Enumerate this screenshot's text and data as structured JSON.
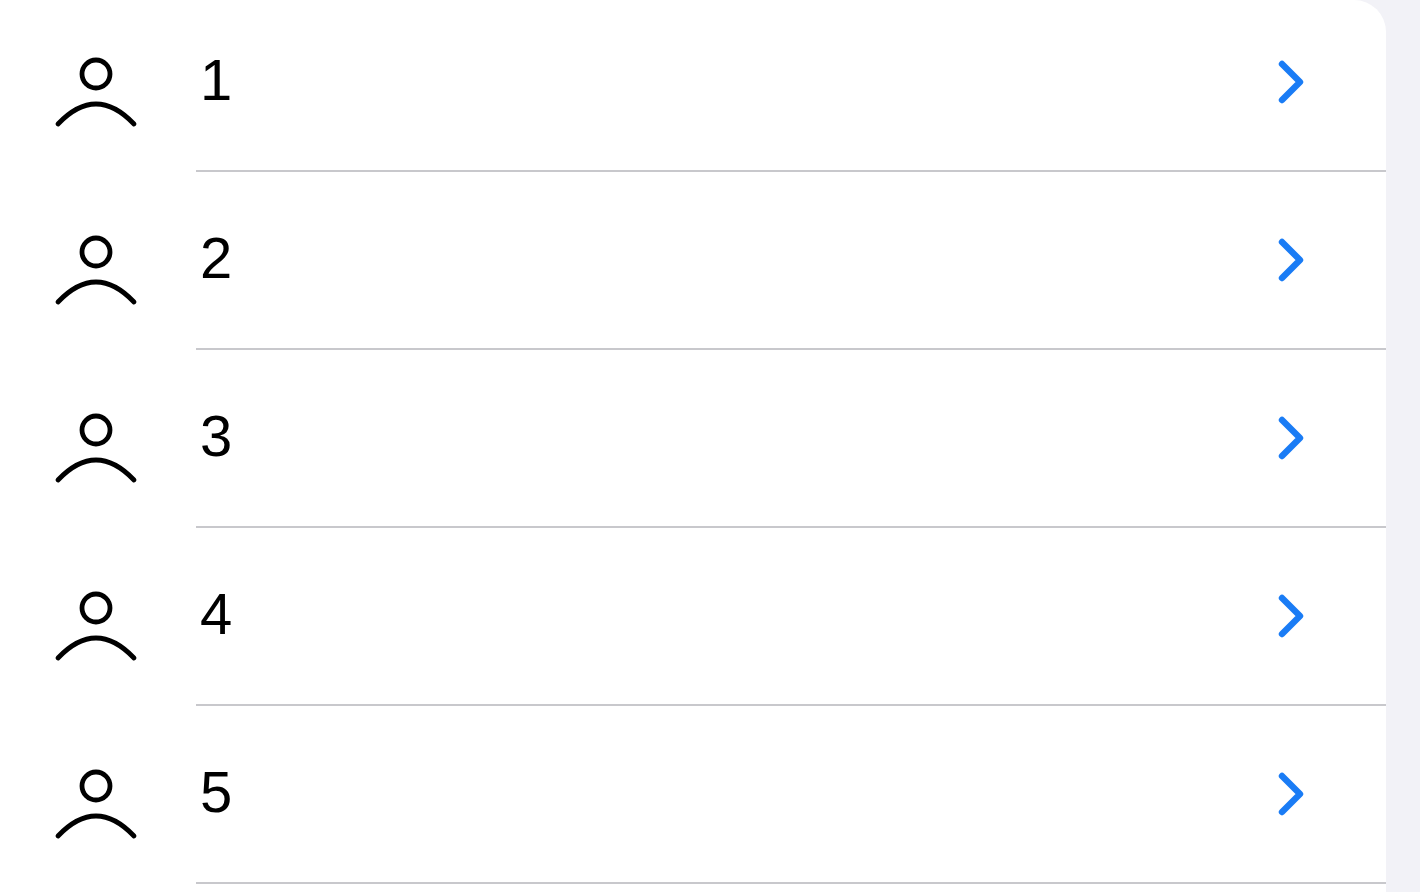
{
  "rows": [
    {
      "label": "1"
    },
    {
      "label": "2"
    },
    {
      "label": "3"
    },
    {
      "label": "4"
    },
    {
      "label": "5"
    }
  ]
}
